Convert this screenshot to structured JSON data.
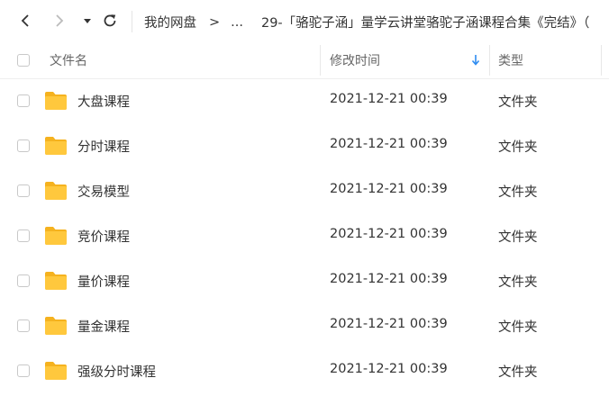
{
  "toolbar": {
    "back_icon": "chevron-left-icon",
    "forward_icon": "chevron-right-icon",
    "history_icon": "caret-down-icon",
    "refresh_icon": "refresh-icon"
  },
  "breadcrumb": {
    "root": "我的网盘",
    "separator": ">",
    "ellipsis": "...",
    "current": "29-「骆驼子涵」量学云讲堂骆驼子涵课程合集《完结》（"
  },
  "table": {
    "headers": {
      "name": "文件名",
      "modified": "修改时间",
      "type": "类型"
    },
    "sort_indicator": "arrow-down-icon",
    "rows": [
      {
        "name": "大盘课程",
        "modified": "2021-12-21 00:39",
        "type": "文件夹"
      },
      {
        "name": "分时课程",
        "modified": "2021-12-21 00:39",
        "type": "文件夹"
      },
      {
        "name": "交易模型",
        "modified": "2021-12-21 00:39",
        "type": "文件夹"
      },
      {
        "name": "竞价课程",
        "modified": "2021-12-21 00:39",
        "type": "文件夹"
      },
      {
        "name": "量价课程",
        "modified": "2021-12-21 00:39",
        "type": "文件夹"
      },
      {
        "name": "量金课程",
        "modified": "2021-12-21 00:39",
        "type": "文件夹"
      },
      {
        "name": "强级分时课程",
        "modified": "2021-12-21 00:39",
        "type": "文件夹"
      }
    ]
  },
  "colors": {
    "folder": "#FFC83D",
    "folder_tab": "#F5B21F",
    "sort_arrow": "#2E8CF0"
  }
}
